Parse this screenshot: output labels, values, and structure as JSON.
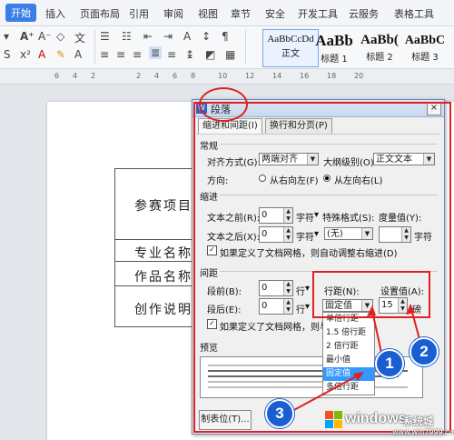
{
  "ribbon": {
    "tabs": [
      "开始",
      "插入",
      "页面布局",
      "引用",
      "审阅",
      "视图",
      "章节",
      "安全",
      "开发工具",
      "云服务",
      "表格工具"
    ],
    "active_tab": "开始"
  },
  "styles": [
    {
      "preview": "AaBbCcDd",
      "label": "正文"
    },
    {
      "preview": "AaBb",
      "label": "标题 1"
    },
    {
      "preview": "AaBb(",
      "label": "标题 2"
    },
    {
      "preview": "AaBbC",
      "label": "标题 3"
    }
  ],
  "ruler": {
    "marks": [
      "6",
      "4",
      "2",
      "2",
      "4",
      "6",
      "8",
      "10",
      "12",
      "14",
      "16",
      "18",
      "20"
    ]
  },
  "document": {
    "cells": [
      "参赛项目",
      "专业名称",
      "作品名称",
      "创作说明"
    ]
  },
  "dialog": {
    "title": "段落",
    "close": "×",
    "tabs": [
      "缩进和间距(I)",
      "换行和分页(P)"
    ],
    "general": {
      "heading": "常规",
      "align_label": "对齐方式(G):",
      "align_value": "两端对齐",
      "outline_label": "大纲级别(O):",
      "outline_value": "正文文本",
      "direction_label": "方向:",
      "rtl_label": "从右向左(F)",
      "ltr_label": "从左向右(L)"
    },
    "indent": {
      "heading": "缩进",
      "before_label": "文本之前(R):",
      "before_value": "0",
      "before_unit": "字符",
      "after_label": "文本之后(X):",
      "after_value": "0",
      "after_unit": "字符",
      "special_label": "特殊格式(S):",
      "special_value": "(无)",
      "measure_label": "度量值(Y):",
      "measure_unit": "字符",
      "grid_check": "如果定义了文档网格，则自动调整右缩进(D)"
    },
    "spacing": {
      "heading": "间距",
      "before_label": "段前(B):",
      "before_value": "0",
      "before_unit": "行",
      "after_label": "段后(E):",
      "after_value": "0",
      "after_unit": "行",
      "line_label": "行距(N):",
      "line_value": "固定值",
      "set_label": "设置值(A):",
      "set_value": "15",
      "set_unit": "磅",
      "grid_check": "如果定义了文档网格，则与网"
    },
    "line_options": [
      "单倍行距",
      "1.5 倍行距",
      "2 倍行距",
      "最小值",
      "固定值",
      "多倍行距"
    ],
    "selected_option": "固定值",
    "preview_heading": "预览",
    "tabstop_button": "制表位(T)..."
  },
  "annotations": {
    "badge1": "1",
    "badge2": "2",
    "badge3": "3"
  },
  "watermark": {
    "brand": "windows",
    "site": "www.win7999.com",
    "caption": "系统城"
  },
  "colors": {
    "accent": "#3a7ee8",
    "highlight": "#e02020",
    "badge": "#1a5fd1"
  }
}
